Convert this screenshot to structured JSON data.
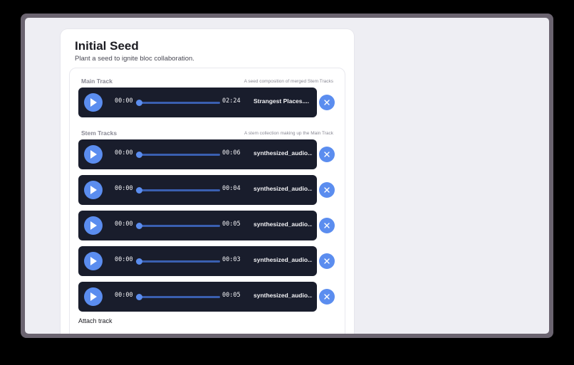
{
  "card": {
    "title": "Initial Seed",
    "subtitle": "Plant a seed to ignite bloc collaboration."
  },
  "main_track": {
    "label": "Main Track",
    "hint": "A seed composition of merged Stem Tracks",
    "player": {
      "current": "00:00",
      "duration": "02:24",
      "name": "Strangest Places....",
      "progress": 0
    }
  },
  "stem_tracks": {
    "label": "Stem Tracks",
    "hint": "A stem collection making up the Main Track",
    "players": [
      {
        "current": "00:00",
        "duration": "00:06",
        "name": "synthesized_audio...",
        "progress": 0
      },
      {
        "current": "00:00",
        "duration": "00:04",
        "name": "synthesized_audio...",
        "progress": 0
      },
      {
        "current": "00:00",
        "duration": "00:05",
        "name": "synthesized_audio...",
        "progress": 0
      },
      {
        "current": "00:00",
        "duration": "00:03",
        "name": "synthesized_audio...",
        "progress": 0
      },
      {
        "current": "00:00",
        "duration": "00:05",
        "name": "synthesized_audio...",
        "progress": 0
      }
    ]
  },
  "attach": {
    "label": "Attach track"
  },
  "icons": {
    "play": "play-icon",
    "remove": "close-icon"
  },
  "colors": {
    "accent": "#5b8def",
    "player_bg": "#191d2c",
    "page_bg": "#eeeef3"
  }
}
